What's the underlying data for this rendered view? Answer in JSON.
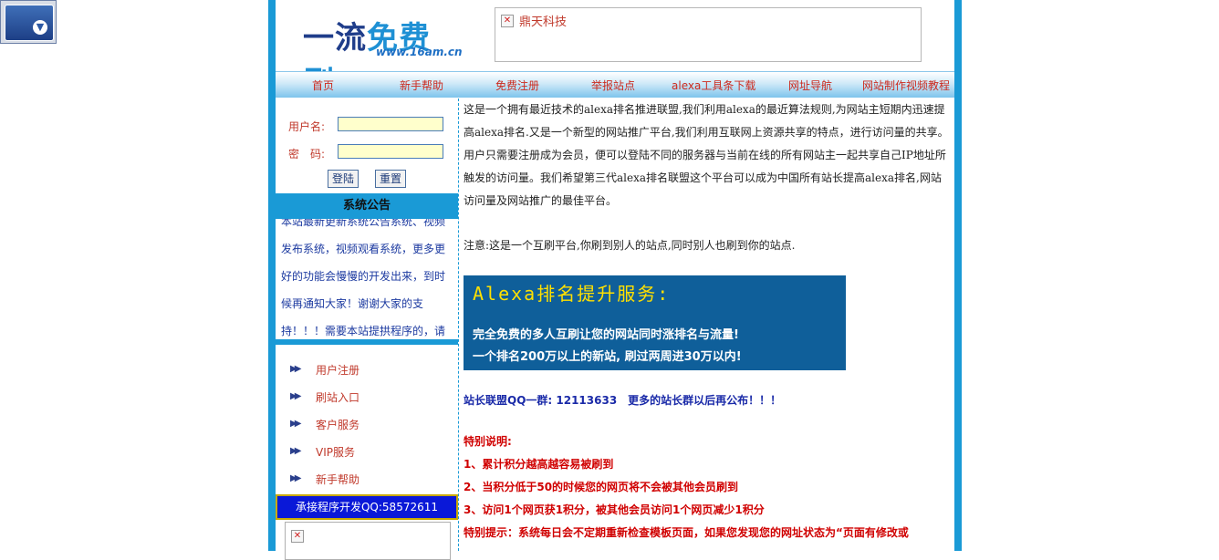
{
  "logo": {
    "main_left": "一流",
    "main_right": "免费刷",
    "url": "www.16am.cn"
  },
  "header_ad": {
    "text": "鼎天科技"
  },
  "nav": [
    "首页",
    "新手帮助",
    "免费注册",
    "举报站点",
    "alexa工具条下载",
    "网址导航",
    "网站制作视频教程"
  ],
  "login": {
    "username_label": "用户名:",
    "password_label": "密　码:",
    "login_button": "登陆",
    "reset_button": "重置"
  },
  "notice": {
    "title": "系统公告",
    "body": "本站最新更新系统公告系统、视频发布系统，视频观看系统，更多更好的功能会慢慢的开发出来，到时候再通知大家！谢谢大家的支持！！！需要本站提拱程序的，请"
  },
  "menu": [
    "用户注册",
    "刷站入口",
    "客户服务",
    "VIP服务",
    "新手帮助"
  ],
  "contact": "承接程序开发QQ:58572611",
  "main": {
    "intro": "这是一个拥有最近技术的alexa排名推进联盟,我们利用alexa的最近算法规则,为网站主短期内迅速提高alexa排名.又是一个新型的网站推广平台,我们利用互联网上资源共享的特点，进行访问量的共享。用户只需要注册成为会员，便可以登陆不同的服务器与当前在线的所有网站主一起共享自己IP地址所触发的访问量。我们希望第三代alexa排名联盟这个平台可以成为中国所有站长提高alexa排名,网站访问量及网站推广的最佳平台。",
    "note": "注意:这是一个互刷平台,你刷到别人的站点,同时别人也刷到你的站点.",
    "banner": {
      "title": "Alexa排名提升服务:",
      "line1": "完全免费的多人互刷让您的网站同时涨排名与流量!",
      "line2": "一个排名200万以上的新站, 刷过两周进30万以内!"
    },
    "qq_group": "站长联盟QQ一群: 12113633　更多的站长群以后再公布！！！",
    "special_title": "特别说明:",
    "special_items": [
      "1、累计积分越高越容易被刷到",
      "2、当积分低于50的时候您的网页将不会被其他会员刷到",
      "3、访问1个网页获1积分，被其他会员访问1个网页减少1积分",
      "特别提示：系统每日会不定期重新检查模板页面，如果您发现您的网址状态为“页面有修改或"
    ]
  }
}
